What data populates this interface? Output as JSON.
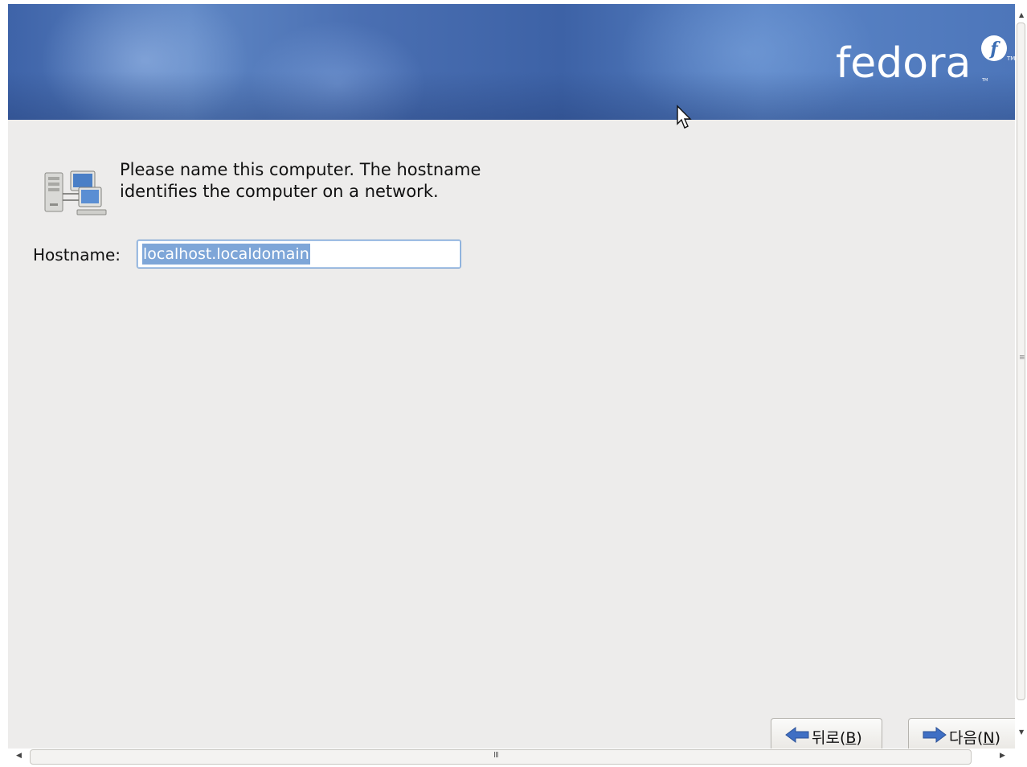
{
  "header": {
    "logo_text": "fedora",
    "logo_badge": "f",
    "trademark": "TM"
  },
  "main": {
    "icon": "network-computers-icon",
    "description": "Please name this computer.  The hostname identifies the computer on a network.",
    "hostname_label": "Hostname:",
    "hostname_value": "localhost.localdomain"
  },
  "buttons": {
    "back": {
      "label_prefix": "뒤로(",
      "accel": "B",
      "label_suffix": ")",
      "icon": "left-arrow-icon"
    },
    "next": {
      "label_prefix": "다음(",
      "accel": "N",
      "label_suffix": ")",
      "icon": "right-arrow-icon"
    }
  },
  "scrollbar": {
    "grip_h": "III",
    "grip_v": "≡"
  },
  "colors": {
    "banner": "#4a6fb2",
    "background": "#edeceb",
    "selection": "#7ea6d8",
    "arrow": "#3f6fc4"
  }
}
